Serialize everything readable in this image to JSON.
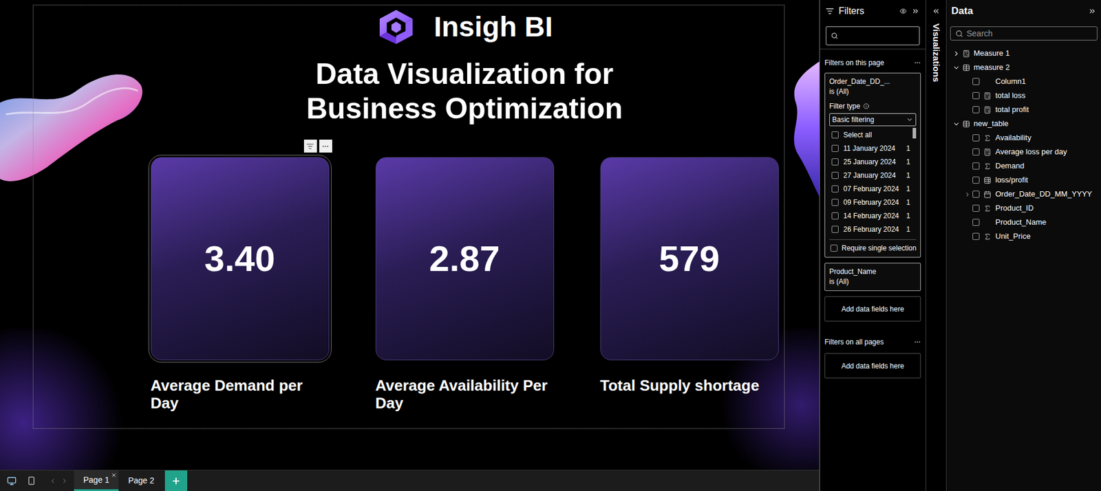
{
  "report": {
    "logo": {
      "text": "Insigh BI"
    },
    "title_lines": [
      "Data Visualization for",
      "Business Optimization"
    ],
    "cards": [
      {
        "value": "3.40",
        "label": "Average Demand per Day",
        "selected": true
      },
      {
        "value": "2.87",
        "label": "Average Availability Per Day",
        "selected": false
      },
      {
        "value": "579",
        "label": "Total Supply shortage",
        "selected": false
      }
    ]
  },
  "filters_pane": {
    "title": "Filters",
    "search": {
      "placeholder": ""
    },
    "page_section": {
      "label": "Filters on this page",
      "filters": [
        {
          "field": "Order_Date_DD_...",
          "summary": "is (All)",
          "expanded": true,
          "filter_type_label": "Filter type",
          "filter_type": "Basic filtering",
          "select_all": {
            "label": "Select all",
            "checked": false
          },
          "values": [
            {
              "label": "11 January 2024",
              "count": "1",
              "checked": false
            },
            {
              "label": "25 January 2024",
              "count": "1",
              "checked": false
            },
            {
              "label": "27 January 2024",
              "count": "1",
              "checked": false
            },
            {
              "label": "07 February 2024",
              "count": "1",
              "checked": false
            },
            {
              "label": "09 February 2024",
              "count": "1",
              "checked": false
            },
            {
              "label": "14 February 2024",
              "count": "1",
              "checked": false
            },
            {
              "label": "26 February 2024",
              "count": "1",
              "checked": false
            }
          ],
          "require_single_selection": {
            "label": "Require single selection",
            "checked": false
          }
        },
        {
          "field": "Product_Name",
          "summary": "is (All)",
          "expanded": false
        }
      ],
      "add_label": "Add data fields here"
    },
    "all_pages_section": {
      "label": "Filters on all pages",
      "add_label": "Add data fields here"
    }
  },
  "visualizations_pane": {
    "label": "Visualizations",
    "expanded": false
  },
  "data_pane": {
    "title": "Data",
    "search": {
      "placeholder": "Search"
    },
    "tree": [
      {
        "label": "Measure 1",
        "kind": "measure-table",
        "expanded": false,
        "children": []
      },
      {
        "label": "measure 2",
        "kind": "table",
        "expanded": true,
        "children": [
          {
            "label": "Column1",
            "kind": "column",
            "checked": false
          },
          {
            "label": "total loss",
            "kind": "measure",
            "checked": false
          },
          {
            "label": "total profit",
            "kind": "measure",
            "checked": false
          }
        ]
      },
      {
        "label": "new_table",
        "kind": "table",
        "expanded": true,
        "children": [
          {
            "label": "Availability",
            "kind": "sum",
            "checked": false
          },
          {
            "label": "Average loss per day",
            "kind": "measure",
            "checked": false
          },
          {
            "label": "Demand",
            "kind": "sum",
            "checked": false
          },
          {
            "label": "loss/profit",
            "kind": "calc-column",
            "checked": false
          },
          {
            "label": "Order_Date_DD_MM_YYYY",
            "kind": "date",
            "checked": false,
            "expanded": false
          },
          {
            "label": "Product_ID",
            "kind": "sum",
            "checked": false
          },
          {
            "label": "Product_Name",
            "kind": "column",
            "checked": false
          },
          {
            "label": "Unit_Price",
            "kind": "sum",
            "checked": false
          }
        ]
      }
    ]
  },
  "page_tabs": [
    {
      "label": "Page 1",
      "selected": true,
      "closable": true
    },
    {
      "label": "Page 2",
      "selected": false,
      "closable": false
    }
  ]
}
